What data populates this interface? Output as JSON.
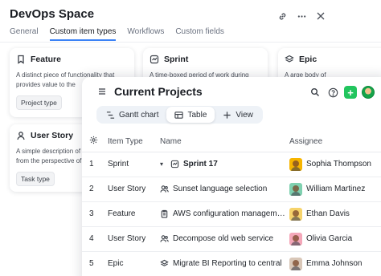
{
  "space": {
    "title": "DevOps Space",
    "tabs": [
      {
        "label": "General",
        "active": false
      },
      {
        "label": "Custom item types",
        "active": true
      },
      {
        "label": "Workflows",
        "active": false
      },
      {
        "label": "Custom fields",
        "active": false
      }
    ],
    "actions": [
      "link-icon",
      "more-icon",
      "close-icon"
    ]
  },
  "item_types": [
    {
      "name": "Feature",
      "icon": "bookmark-icon",
      "desc1": "A distinct piece of functionality that",
      "desc2": "provides value to the",
      "tag": "Project type"
    },
    {
      "name": "Sprint",
      "icon": "sprint-icon",
      "desc1": "A time-boxed period of work during",
      "desc2": "",
      "tag": ""
    },
    {
      "name": "Epic",
      "icon": "stack-icon",
      "desc1": "A arge body of",
      "desc2": "",
      "tag": ""
    },
    {
      "name": "User Story",
      "icon": "user-icon",
      "desc1": "A simple description of",
      "desc2": "from the perspective of",
      "tag": "Task type"
    }
  ],
  "projects": {
    "title": "Current Projects",
    "views": [
      {
        "label": "Gantt chart",
        "icon": "gantt-icon",
        "active": false
      },
      {
        "label": "Table",
        "icon": "table-icon",
        "active": true
      },
      {
        "label": "View",
        "icon": "plus-icon",
        "active": false
      }
    ],
    "columns": {
      "type": "Item Type",
      "name": "Name",
      "assignee": "Assignee"
    },
    "rows": [
      {
        "num": "1",
        "type": "Sprint",
        "name": "Sprint 17",
        "assignee": "Sophia Thompson",
        "avatar_color": "#f7b500"
      },
      {
        "num": "2",
        "type": "User Story",
        "name": "Sunset language selection",
        "assignee": "William Martinez",
        "avatar_color": "#7fd1b0"
      },
      {
        "num": "3",
        "type": "Feature",
        "name": "AWS configuration management",
        "assignee": "Ethan Davis",
        "avatar_color": "#f6d36b"
      },
      {
        "num": "4",
        "type": "User Story",
        "name": "Decompose old web service",
        "assignee": "Olivia Garcia",
        "avatar_color": "#f4a7b9"
      },
      {
        "num": "5",
        "type": "Epic",
        "name": "Migrate BI Reporting to central",
        "assignee": "Emma Johnson",
        "avatar_color": "#d9c7b8"
      }
    ]
  }
}
